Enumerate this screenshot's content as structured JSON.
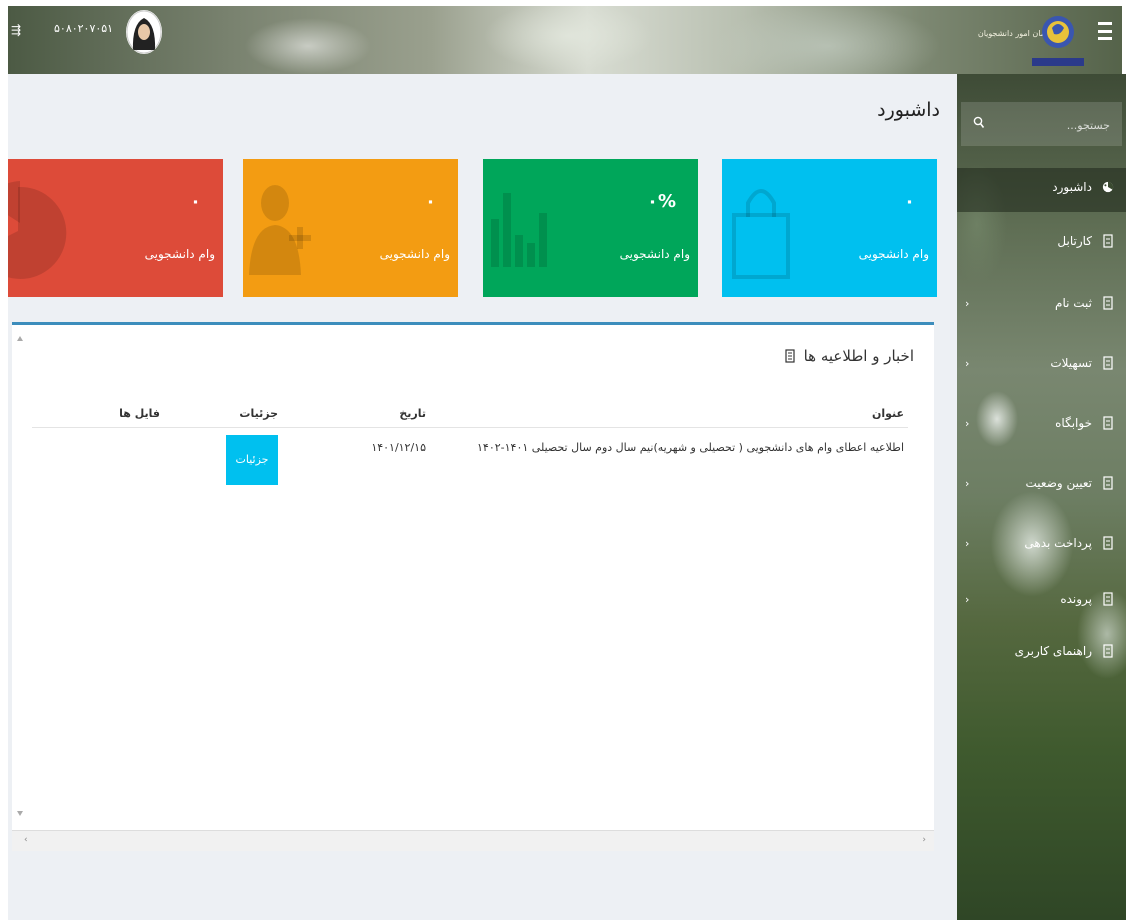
{
  "header": {
    "user_id": "۵۰۸۰۲۰۷۰۵۱",
    "brand_text": "سازمان امور دانشجویان"
  },
  "sidebar": {
    "search_placeholder": "جستجو...",
    "items": [
      {
        "label": "داشبورد",
        "icon": "dashboard-icon",
        "active": true,
        "has_children": false
      },
      {
        "label": "کارتابل",
        "icon": "document-icon",
        "active": false,
        "has_children": false
      },
      {
        "label": "ثبت نام",
        "icon": "document-icon",
        "active": false,
        "has_children": true
      },
      {
        "label": "تسهیلات",
        "icon": "document-icon",
        "active": false,
        "has_children": true
      },
      {
        "label": "خوابگاه",
        "icon": "document-icon",
        "active": false,
        "has_children": true
      },
      {
        "label": "تعیین وضعیت",
        "icon": "document-icon",
        "active": false,
        "has_children": true
      },
      {
        "label": "پرداخت بدهی",
        "icon": "document-icon",
        "active": false,
        "has_children": true
      },
      {
        "label": "پرونده",
        "icon": "document-icon",
        "active": false,
        "has_children": true
      },
      {
        "label": "راهنمای کاربری",
        "icon": "document-icon",
        "active": false,
        "has_children": false
      }
    ]
  },
  "main": {
    "title": "داشبورد",
    "cards": [
      {
        "value": "۰",
        "label": "وام دانشجویی",
        "color": "#00c0ef",
        "icon": "shopping-bag-icon"
      },
      {
        "value": "۰%",
        "label": "وام دانشجویی",
        "color": "#00a65a",
        "icon": "bar-chart-icon"
      },
      {
        "value": "۰",
        "label": "وام دانشجویی",
        "color": "#f39c12",
        "icon": "add-user-icon"
      },
      {
        "value": "۰",
        "label": "وام دانشجویی",
        "color": "#dd4b39",
        "icon": "pie-chart-icon"
      }
    ],
    "news": {
      "title": "اخبار و اطلاعیه ها",
      "columns": [
        "عنوان",
        "تاریخ",
        "جزئیات",
        "فایل ها"
      ],
      "rows": [
        {
          "title": "اطلاعیه اعطای وام های دانشجویی ( تحصیلی و شهریه)نیم سال دوم سال تحصیلی ۱۴۰۱-۱۴۰۲",
          "date": "۱۴۰۱/۱۲/۱۵",
          "details_label": "جزئیات",
          "files": ""
        }
      ]
    }
  }
}
